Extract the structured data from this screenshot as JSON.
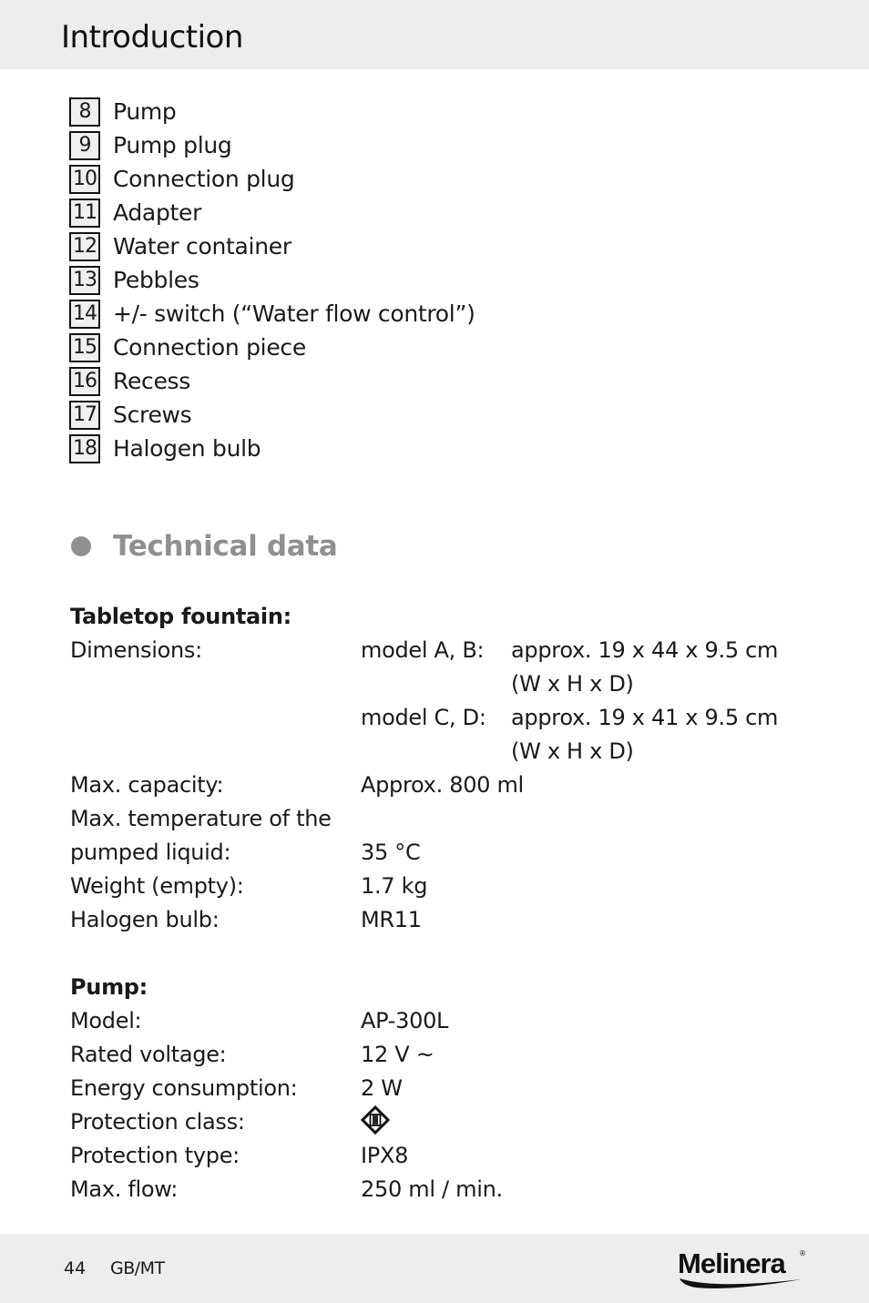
{
  "header": {
    "title": "Introduction"
  },
  "parts": [
    {
      "num": "8",
      "label": "Pump"
    },
    {
      "num": "9",
      "label": "Pump plug"
    },
    {
      "num": "10",
      "label": "Connection plug"
    },
    {
      "num": "11",
      "label": "Adapter"
    },
    {
      "num": "12",
      "label": "Water container"
    },
    {
      "num": "13",
      "label": "Pebbles"
    },
    {
      "num": "14",
      "label": "+/- switch (“Water flow control”)"
    },
    {
      "num": "15",
      "label": "Connection piece"
    },
    {
      "num": "16",
      "label": "Recess"
    },
    {
      "num": "17",
      "label": "Screws"
    },
    {
      "num": "18",
      "label": "Halogen bulb"
    }
  ],
  "section": {
    "title": "Technical data",
    "bullet_color": "#8f9090"
  },
  "fountain": {
    "heading": "Tabletop fountain:",
    "dimensions_label": "Dimensions:",
    "model_ab_label": "model A, B:",
    "model_ab_value": "approx. 19 x 44 x 9.5 cm",
    "model_ab_unit": "(W x H x D)",
    "model_cd_label": "model C, D:",
    "model_cd_value": "approx. 19 x 41 x 9.5 cm",
    "model_cd_unit": "(W x H x D)",
    "rows": [
      {
        "key": "Max. capacity:",
        "value": "Approx. 800 ml"
      },
      {
        "key": "Max. temperature of the",
        "value": ""
      },
      {
        "key": "pumped liquid:",
        "value": "35 °C"
      },
      {
        "key": "Weight (empty):",
        "value": "1.7 kg"
      },
      {
        "key": "Halogen bulb:",
        "value": "MR11"
      }
    ]
  },
  "pump": {
    "heading": "Pump:",
    "rows": [
      {
        "key": "Model:",
        "value": "AP-300L"
      },
      {
        "key": "Rated voltage:",
        "value": "12 V ~"
      },
      {
        "key": "Energy consumption:",
        "value": "2 W"
      },
      {
        "key": "Protection class:",
        "value": "",
        "icon": "protection-class-iii-icon"
      },
      {
        "key": "Protection type:",
        "value": "IPX8"
      },
      {
        "key": "Max. flow:",
        "value": "250 ml / min."
      }
    ]
  },
  "footer": {
    "page": "44",
    "region": "GB/MT",
    "brand": "Melinera",
    "reg": "®"
  }
}
